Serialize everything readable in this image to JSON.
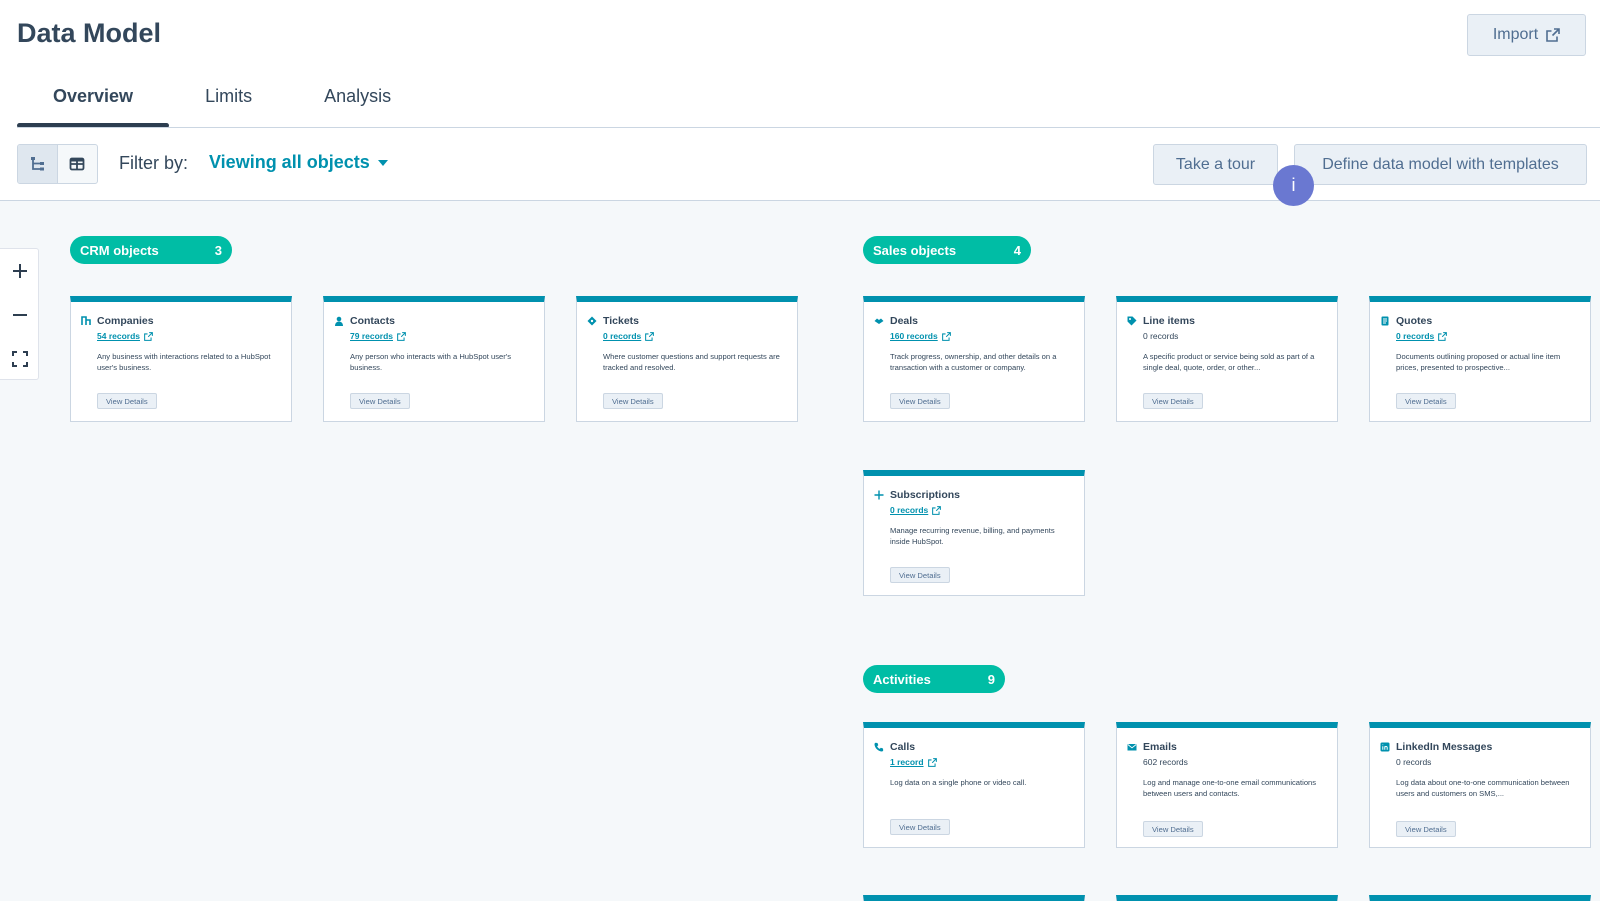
{
  "header": {
    "title": "Data Model",
    "import_label": "Import"
  },
  "tabs": [
    {
      "label": "Overview"
    },
    {
      "label": "Limits"
    },
    {
      "label": "Analysis"
    }
  ],
  "toolbar": {
    "filter_label": "Filter by:",
    "filter_value": "Viewing all objects",
    "tour_label": "Take a tour",
    "define_label": "Define data model with templates",
    "info_label": "i"
  },
  "zoom": {
    "in": "+",
    "out": "–"
  },
  "groups": {
    "crm": {
      "label": "CRM objects",
      "count": "3"
    },
    "sales": {
      "label": "Sales objects",
      "count": "4"
    },
    "activities": {
      "label": "Activities",
      "count": "9"
    }
  },
  "view_details_label": "View Details",
  "cards": {
    "companies": {
      "name": "Companies",
      "records": "54 records",
      "desc": "Any business with interactions related to a HubSpot user's business.",
      "icon": "building-icon"
    },
    "contacts": {
      "name": "Contacts",
      "records": "79 records",
      "desc": "Any person who interacts with a HubSpot user's business.",
      "icon": "person-icon"
    },
    "tickets": {
      "name": "Tickets",
      "records": "0 records",
      "desc": "Where customer questions and support requests are tracked and resolved.",
      "icon": "ticket-icon"
    },
    "deals": {
      "name": "Deals",
      "records": "160 records",
      "desc": "Track progress, ownership, and other details on a transaction with a customer or company.",
      "icon": "handshake-icon"
    },
    "line_items": {
      "name": "Line items",
      "records": "0 records",
      "desc": "A specific product or service being sold as part of a single deal, quote, order, or other...",
      "icon": "tag-icon"
    },
    "quotes": {
      "name": "Quotes",
      "records": "0 records",
      "desc": "Documents outlining proposed or actual line item prices, presented to prospective...",
      "icon": "document-icon"
    },
    "subscriptions": {
      "name": "Subscriptions",
      "records": "0 records",
      "desc": "Manage recurring revenue, billing, and payments inside HubSpot.",
      "icon": "plus-icon"
    },
    "calls": {
      "name": "Calls",
      "records": "1 record",
      "desc": "Log data on a single phone or video call.",
      "icon": "phone-icon"
    },
    "emails": {
      "name": "Emails",
      "records": "602 records",
      "desc": "Log and manage one-to-one email communications between users and contacts.",
      "icon": "envelope-icon"
    },
    "linkedin": {
      "name": "LinkedIn Messages",
      "records": "0 records",
      "desc": "Log data about one-to-one communication between users and customers on SMS,...",
      "icon": "linkedin-icon"
    }
  },
  "colors": {
    "accent": "#0091ae",
    "pill": "#00bda5",
    "info": "#6a78d1",
    "text": "#33475b"
  }
}
